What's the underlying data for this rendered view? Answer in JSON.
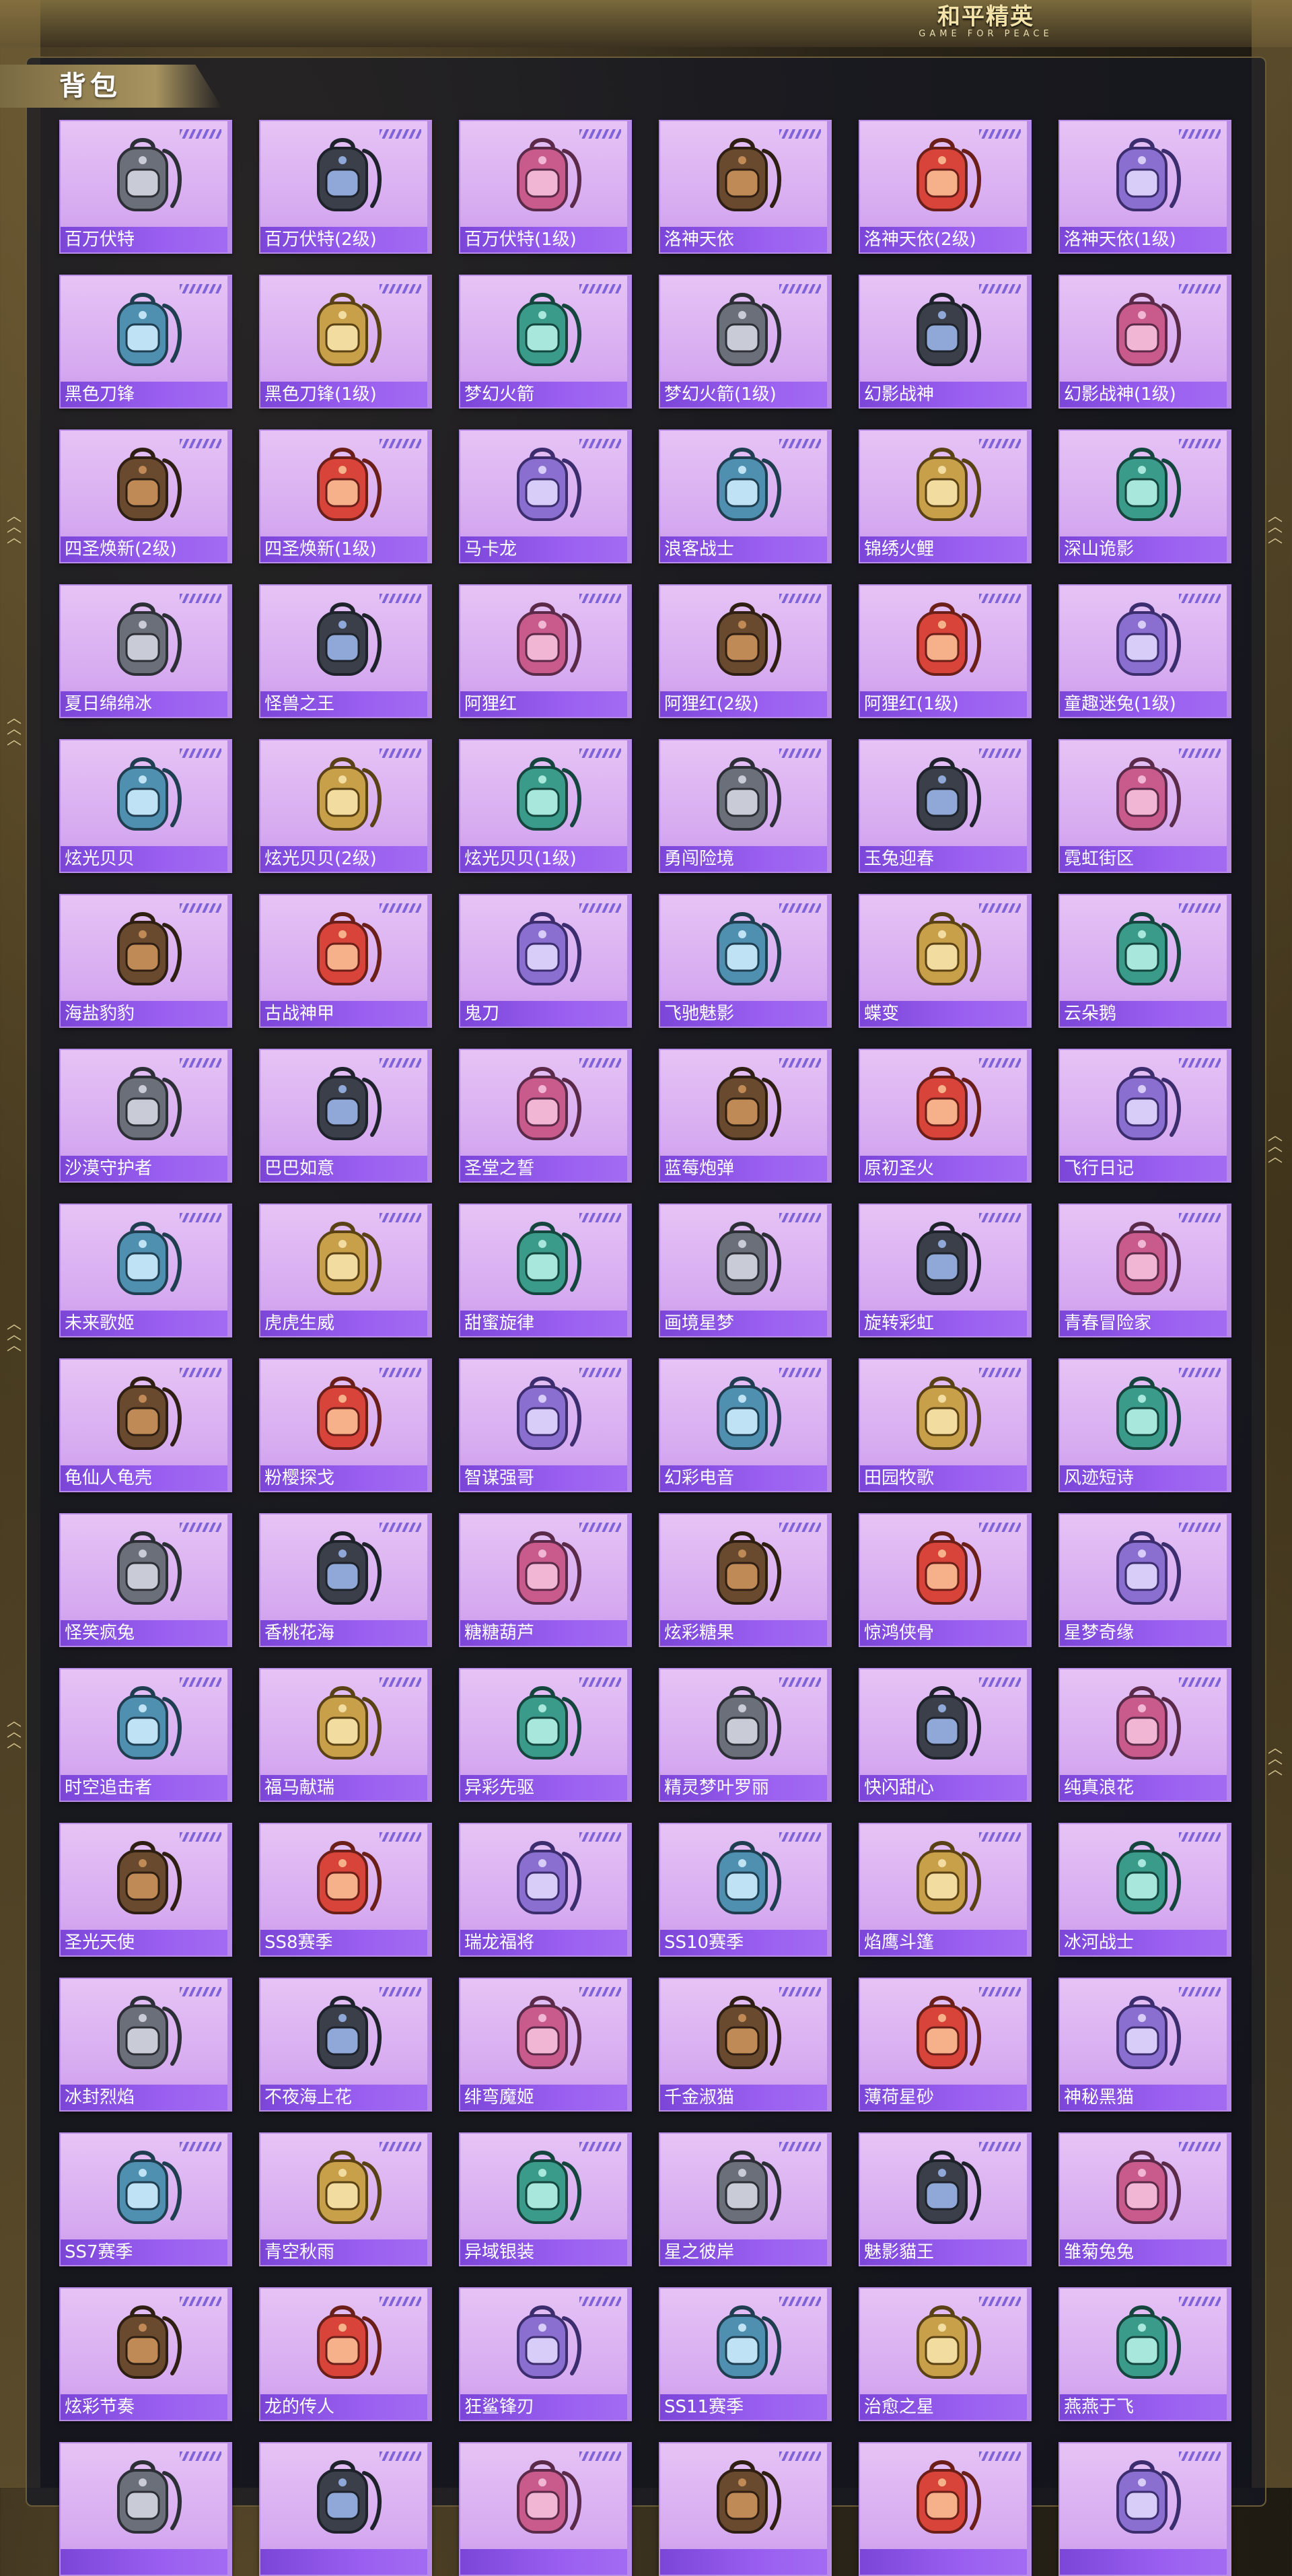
{
  "header": {
    "logo_main": "和平精英",
    "logo_sub": "GAME FOR PEACE"
  },
  "panel": {
    "title": "背包"
  },
  "colors": {
    "card_bg": "#dcb4f3",
    "label_bg": "#8a52e6",
    "accent_stripes": "#7f63d8",
    "panel_border": "#6b5d3a"
  },
  "items": [
    "百万伏特",
    "百万伏特(2级)",
    "百万伏特(1级)",
    "洛神天依",
    "洛神天依(2级)",
    "洛神天依(1级)",
    "黑色刀锋",
    "黑色刀锋(1级)",
    "梦幻火箭",
    "梦幻火箭(1级)",
    "幻影战神",
    "幻影战神(1级)",
    "四圣焕新(2级)",
    "四圣焕新(1级)",
    "马卡龙",
    "浪客战士",
    "锦绣火鲤",
    "深山诡影",
    "夏日绵绵冰",
    "怪兽之王",
    "阿狸红",
    "阿狸红(2级)",
    "阿狸红(1级)",
    "童趣迷兔(1级)",
    "炫光贝贝",
    "炫光贝贝(2级)",
    "炫光贝贝(1级)",
    "勇闯险境",
    "玉兔迎春",
    "霓虹街区",
    "海盐豹豹",
    "古战神甲",
    "鬼刀",
    "飞驰魅影",
    "蝶变",
    "云朵鹅",
    "沙漠守护者",
    "巴巴如意",
    "圣堂之誓",
    "蓝莓炮弹",
    "原初圣火",
    "飞行日记",
    "未来歌姬",
    "虎虎生威",
    "甜蜜旋律",
    "画境星梦",
    "旋转彩虹",
    "青春冒险家",
    "龟仙人龟壳",
    "粉樱探戈",
    "智谋强哥",
    "幻彩电音",
    "田园牧歌",
    "风迹短诗",
    "怪笑疯兔",
    "香桃花海",
    "糖糖葫芦",
    "炫彩糖果",
    "惊鸿侠骨",
    "星梦奇缘",
    "时空追击者",
    "福马献瑞",
    "异彩先驱",
    "精灵梦叶罗丽",
    "快闪甜心",
    "纯真浪花",
    "圣光天使",
    "SS8赛季",
    "瑞龙福将",
    "SS10赛季",
    "焰鹰斗篷",
    "冰河战士",
    "冰封烈焰",
    "不夜海上花",
    "绯弯魔姬",
    "千金淑猫",
    "薄荷星砂",
    "神秘黑猫",
    "SS7赛季",
    "青空秋雨",
    "异域银装",
    "星之彼岸",
    "魅影貓王",
    "雏菊兔兔",
    "炫彩节奏",
    "龙的传人",
    "狂鲨锋刃",
    "SS11赛季",
    "治愈之星",
    "燕燕于飞",
    "",
    "",
    "",
    "",
    "",
    ""
  ]
}
